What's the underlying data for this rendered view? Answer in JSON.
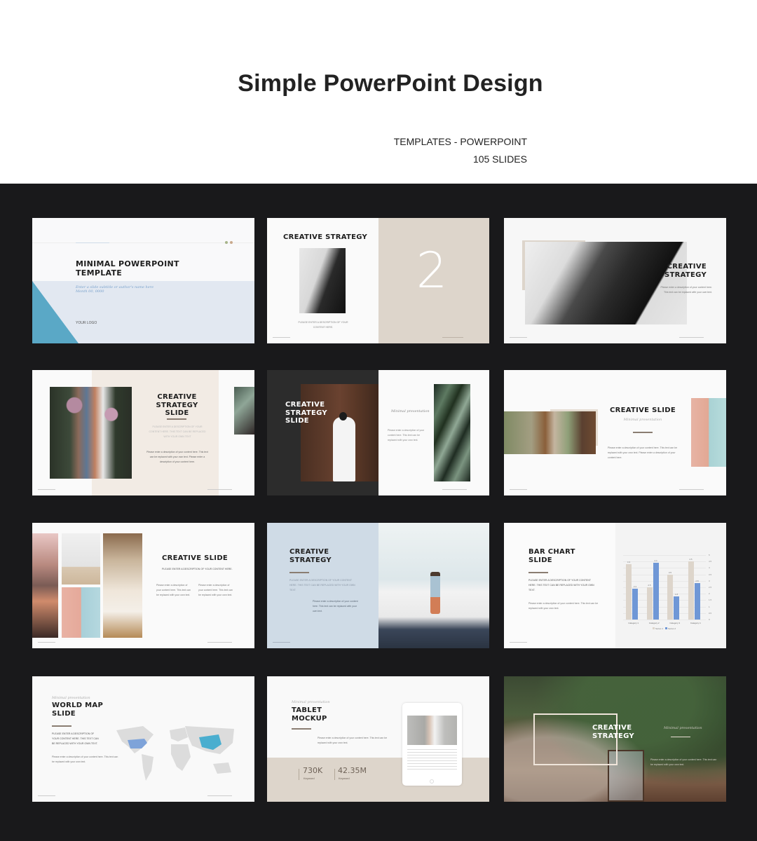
{
  "header": {
    "title": "Simple PowerPoint Design",
    "category": "TEMPLATES - POWERPOINT",
    "slide_count": "105 SLIDES"
  },
  "colors": {
    "gallery_bg": "#19191b",
    "beige": "#ddd5cb",
    "light_blue": "#cfdbe6",
    "accent_blue": "#5aa8c6",
    "bar_series1": "#ddd5cb",
    "bar_series2": "#6f97d6"
  },
  "slides": [
    {
      "title": "MINIMAL POWERPOINT TEMPLATE",
      "title_l1": "MINIMAL POWERPOINT",
      "title_l2": "TEMPLATE",
      "subtitle": "Enter a slide subtitle or author's name here",
      "date": "Month 00, 0000",
      "logo": "YOUR LOGO"
    },
    {
      "title": "CREATIVE STRATEGY",
      "number": "2",
      "caption_l1": "PLEASE ENTER A DESCRIPTION OF YOUR",
      "caption_l2": "CONTENT HERE."
    },
    {
      "title_l1": "CREATIVE",
      "title_l2": "STRATEGY",
      "body": "Please enter a description of your content here. This text can be replaced with your own text."
    },
    {
      "title_l1": "CREATIVE",
      "title_l2": "STRATEGY SLIDE",
      "caption": "PLEASE ENTER A DESCRIPTION OF YOUR CONTENT HERE. THIS TEXT CAN BE REPLACED WITH YOUR OWN TEXT",
      "body": "Please enter a description of your content here. This text can be replaced with your own text. Please enter a description of your content here."
    },
    {
      "title_l1": "CREATIVE",
      "title_l2": "STRATEGY",
      "title_l3": "SLIDE",
      "tagline": "Minimal presentation",
      "body": "Please enter a description of your content here. This text can be replaced with your own text."
    },
    {
      "title": "CREATIVE SLIDE",
      "tagline": "Minimal presentation",
      "body": "Please enter a description of your content here. This text can be replaced with your own text. Please enter a description of your content here."
    },
    {
      "title": "CREATIVE SLIDE",
      "caption": "PLEASE ENTER A DESCRIPTION OF YOUR CONTENT HERE.",
      "body_col1": "Please enter a description of your content here. This text can be replaced with your own text.",
      "body_col2": "Please enter a description of your content here. This text can be replaced with your own text."
    },
    {
      "title_l1": "CREATIVE",
      "title_l2": "STRATEGY",
      "caption": "PLEASE ENTER A DESCRIPTION OF YOUR CONTENT HERE. THIS TEXT CAN BE REPLACED WITH YOUR OWN TEXT.",
      "body": "Please enter a description of your content here. This text can be replaced with your own text."
    },
    {
      "title_l1": "BAR CHART",
      "title_l2": "SLIDE",
      "caption": "PLEASE ENTER A DESCRIPTION OF YOUR CONTENT HERE. THIS TEXT CAN BE REPLACED WITH YOUR OWN TEXT.",
      "body": "Please enter a description of your content here. This text can be replaced with your own text."
    },
    {
      "tagline": "Minimal presentation",
      "title_l1": "WORLD MAP",
      "title_l2": "SLIDE",
      "caption": "PLEASE ENTER A DESCRIPTION OF YOUR CONTENT HERE. THIS TEXT CAN BE REPLACED WITH YOUR OWN TEXT.",
      "body": "Please enter a description of your content here. This text can be replaced with your own text."
    },
    {
      "tagline": "Minimal presentation",
      "title_l1": "TABLET",
      "title_l2": "MOCKUP",
      "body": "Please enter a description of your content here. This text can be replaced with your own text.",
      "stat1_value": "730K",
      "stat1_label": "Keyword",
      "stat2_value": "42.35M",
      "stat2_label": "Keyword"
    },
    {
      "title_l1": "CREATIVE",
      "title_l2": "STRATEGY",
      "tagline": "Minimal presentation",
      "body": "Please enter a description of your content here. This text can be replaced with your own text."
    }
  ],
  "chart_data": {
    "type": "bar",
    "title": "",
    "categories": [
      "Category 1",
      "Category 2",
      "Category 3",
      "Category 4"
    ],
    "series": [
      {
        "name": "Series 1",
        "values": [
          4.3,
          2.5,
          3.5,
          4.5
        ]
      },
      {
        "name": "Series 2",
        "values": [
          2.4,
          4.4,
          1.8,
          2.8
        ]
      }
    ],
    "ylim": [
      0,
      5
    ],
    "yticks": [
      "0",
      "0.5",
      "1",
      "1.5",
      "2",
      "2.5",
      "3",
      "3.5",
      "4",
      "4.5",
      "5"
    ],
    "y_axis_side": "right",
    "legend": "bottom",
    "grid": true
  }
}
